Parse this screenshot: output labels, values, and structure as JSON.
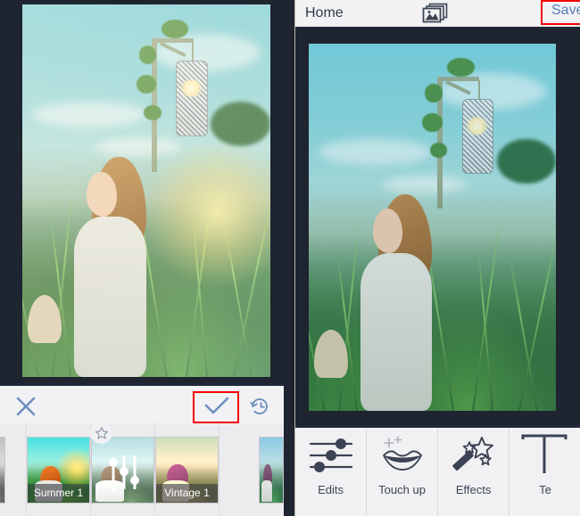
{
  "app": {
    "left_panel": {
      "name": "photo-filter-editor",
      "toolbar": {
        "cancel_icon": "close-x-icon",
        "confirm_icon": "checkmark-icon",
        "history_icon": "history-clock-icon",
        "highlight_color": "#f40000",
        "highlighted_control": "checkmark-icon"
      },
      "filters": [
        {
          "label": "",
          "name": "filter-bw-cut",
          "kind": "photo",
          "starred": false,
          "cut_off": true
        },
        {
          "label": "Summer 1",
          "name": "filter-summer-1",
          "kind": "photo",
          "starred": false,
          "cut_off": false
        },
        {
          "label": "",
          "name": "filter-adjust-sliders",
          "kind": "sliders",
          "starred": true,
          "cut_off": false
        },
        {
          "label": "Vintage 1",
          "name": "filter-vintage-1",
          "kind": "photo",
          "starred": false,
          "cut_off": false
        },
        {
          "label": "",
          "name": "filter-next-cut",
          "kind": "photo",
          "starred": false,
          "cut_off": true
        }
      ],
      "preview_alt": "woman in cream sweater standing in tall grass with hanging lantern, warm filter applied"
    },
    "right_panel": {
      "header": {
        "home_label": "Home",
        "photos_icon": "stacked-photos-icon",
        "save_label": "Save",
        "save_highlight_color": "#f40000",
        "save_text_color": "#5b7fb8"
      },
      "preview_alt": "woman in cream sweater standing in tall grass with hanging lantern, unfiltered",
      "tools": [
        {
          "label": "Edits",
          "icon": "sliders-icon",
          "name": "tool-edits"
        },
        {
          "label": "Touch up",
          "icon": "lips-sparkle-icon",
          "name": "tool-touch-up"
        },
        {
          "label": "Effects",
          "icon": "magic-wand-stars-icon",
          "name": "tool-effects"
        },
        {
          "label": "Te",
          "icon": "text-t-icon",
          "name": "tool-text"
        }
      ]
    },
    "theme": {
      "canvas_bg": "#1e2430",
      "chrome_bg": "#f1f1f3",
      "icon_color": "#3b4354",
      "accent_blue": "#5b7fb8"
    }
  }
}
